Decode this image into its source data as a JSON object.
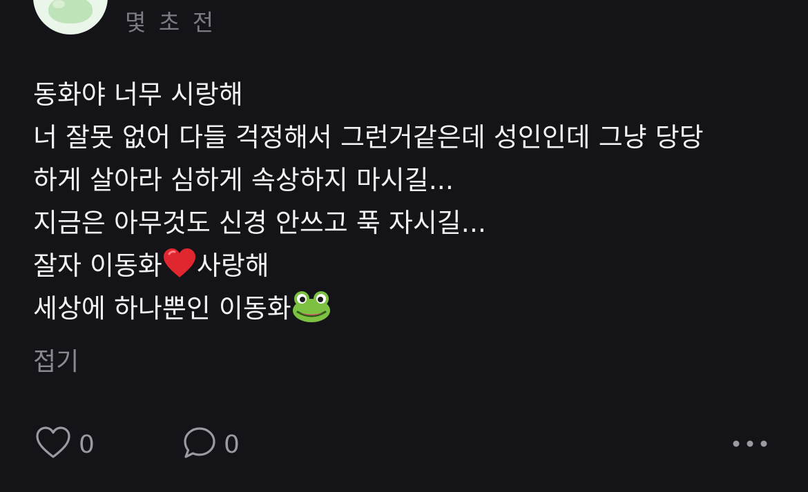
{
  "post": {
    "timestamp": "몇 초 전",
    "lines": [
      "동화야 너무 시랑해",
      "너 잘못 없어 다들 걱정해서 그런거같은데 성인인데 그냥 당당",
      "하게 살아라 심하게 속상하지 마시길...",
      "지금은 아무것도 신경 안쓰고 푹 자시길..."
    ],
    "line5_before": "잘자 이동화",
    "line5_after": "사랑해",
    "line6": "세상에 하나뿐인 이동화",
    "collapse_label": "접기"
  },
  "actions": {
    "like_count": "0",
    "comment_count": "0"
  },
  "icons": {
    "avatar": "frog-avatar",
    "heart_emoji": "red-heart-emoji",
    "frog_emoji": "frog-emoji",
    "like": "heart-outline-icon",
    "comment": "speech-bubble-icon",
    "more": "more-dots-icon"
  },
  "colors": {
    "background": "#141318",
    "text": "#f2f2f4",
    "muted": "#8a898f",
    "heart": "#e0262f",
    "frog": "#7cc142"
  }
}
